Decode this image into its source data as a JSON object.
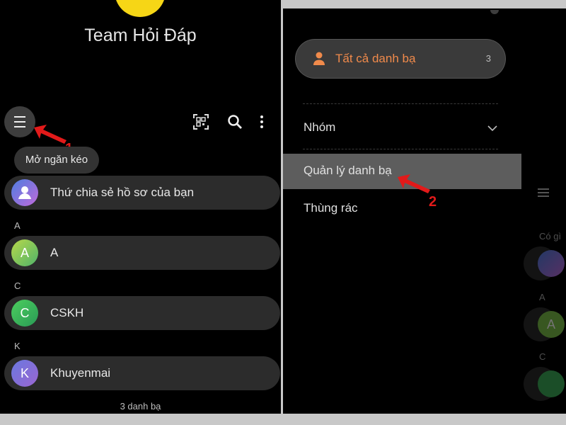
{
  "left": {
    "profile_name": "Team Hỏi Đáp",
    "tooltip": "Mở ngăn kéo",
    "share_profile": "Thứ chia sẻ hồ sơ của bạn",
    "sections": [
      {
        "letter": "A",
        "contact": {
          "initial": "A",
          "name": "A",
          "color": "#7dc24a"
        }
      },
      {
        "letter": "C",
        "contact": {
          "initial": "C",
          "name": "CSKH",
          "color": "#3cae5a"
        }
      },
      {
        "letter": "K",
        "contact": {
          "initial": "K",
          "name": "Khuyenmai",
          "color": "#7a6fd6"
        }
      }
    ],
    "contact_count": "3 danh bạ",
    "annotation_1": "1"
  },
  "right": {
    "all_contacts": {
      "label": "Tất cả danh bạ",
      "count": "3"
    },
    "groups": "Nhóm",
    "manage": "Quản lý danh bạ",
    "trash": "Thùng rác",
    "annotation_2": "2",
    "ghost_text": "Có gì",
    "ghost_letters": [
      "A",
      "A",
      "C"
    ]
  },
  "colors": {
    "accent": "#f08a4b",
    "annotation": "#e21a1a",
    "highlight": "#5d5d5d",
    "profile_avatar": "#f6d616"
  },
  "icons": [
    "menu-icon",
    "qr-code-icon",
    "search-icon",
    "more-vert-icon",
    "person-icon",
    "chevron-down-icon",
    "arrow-icon"
  ]
}
